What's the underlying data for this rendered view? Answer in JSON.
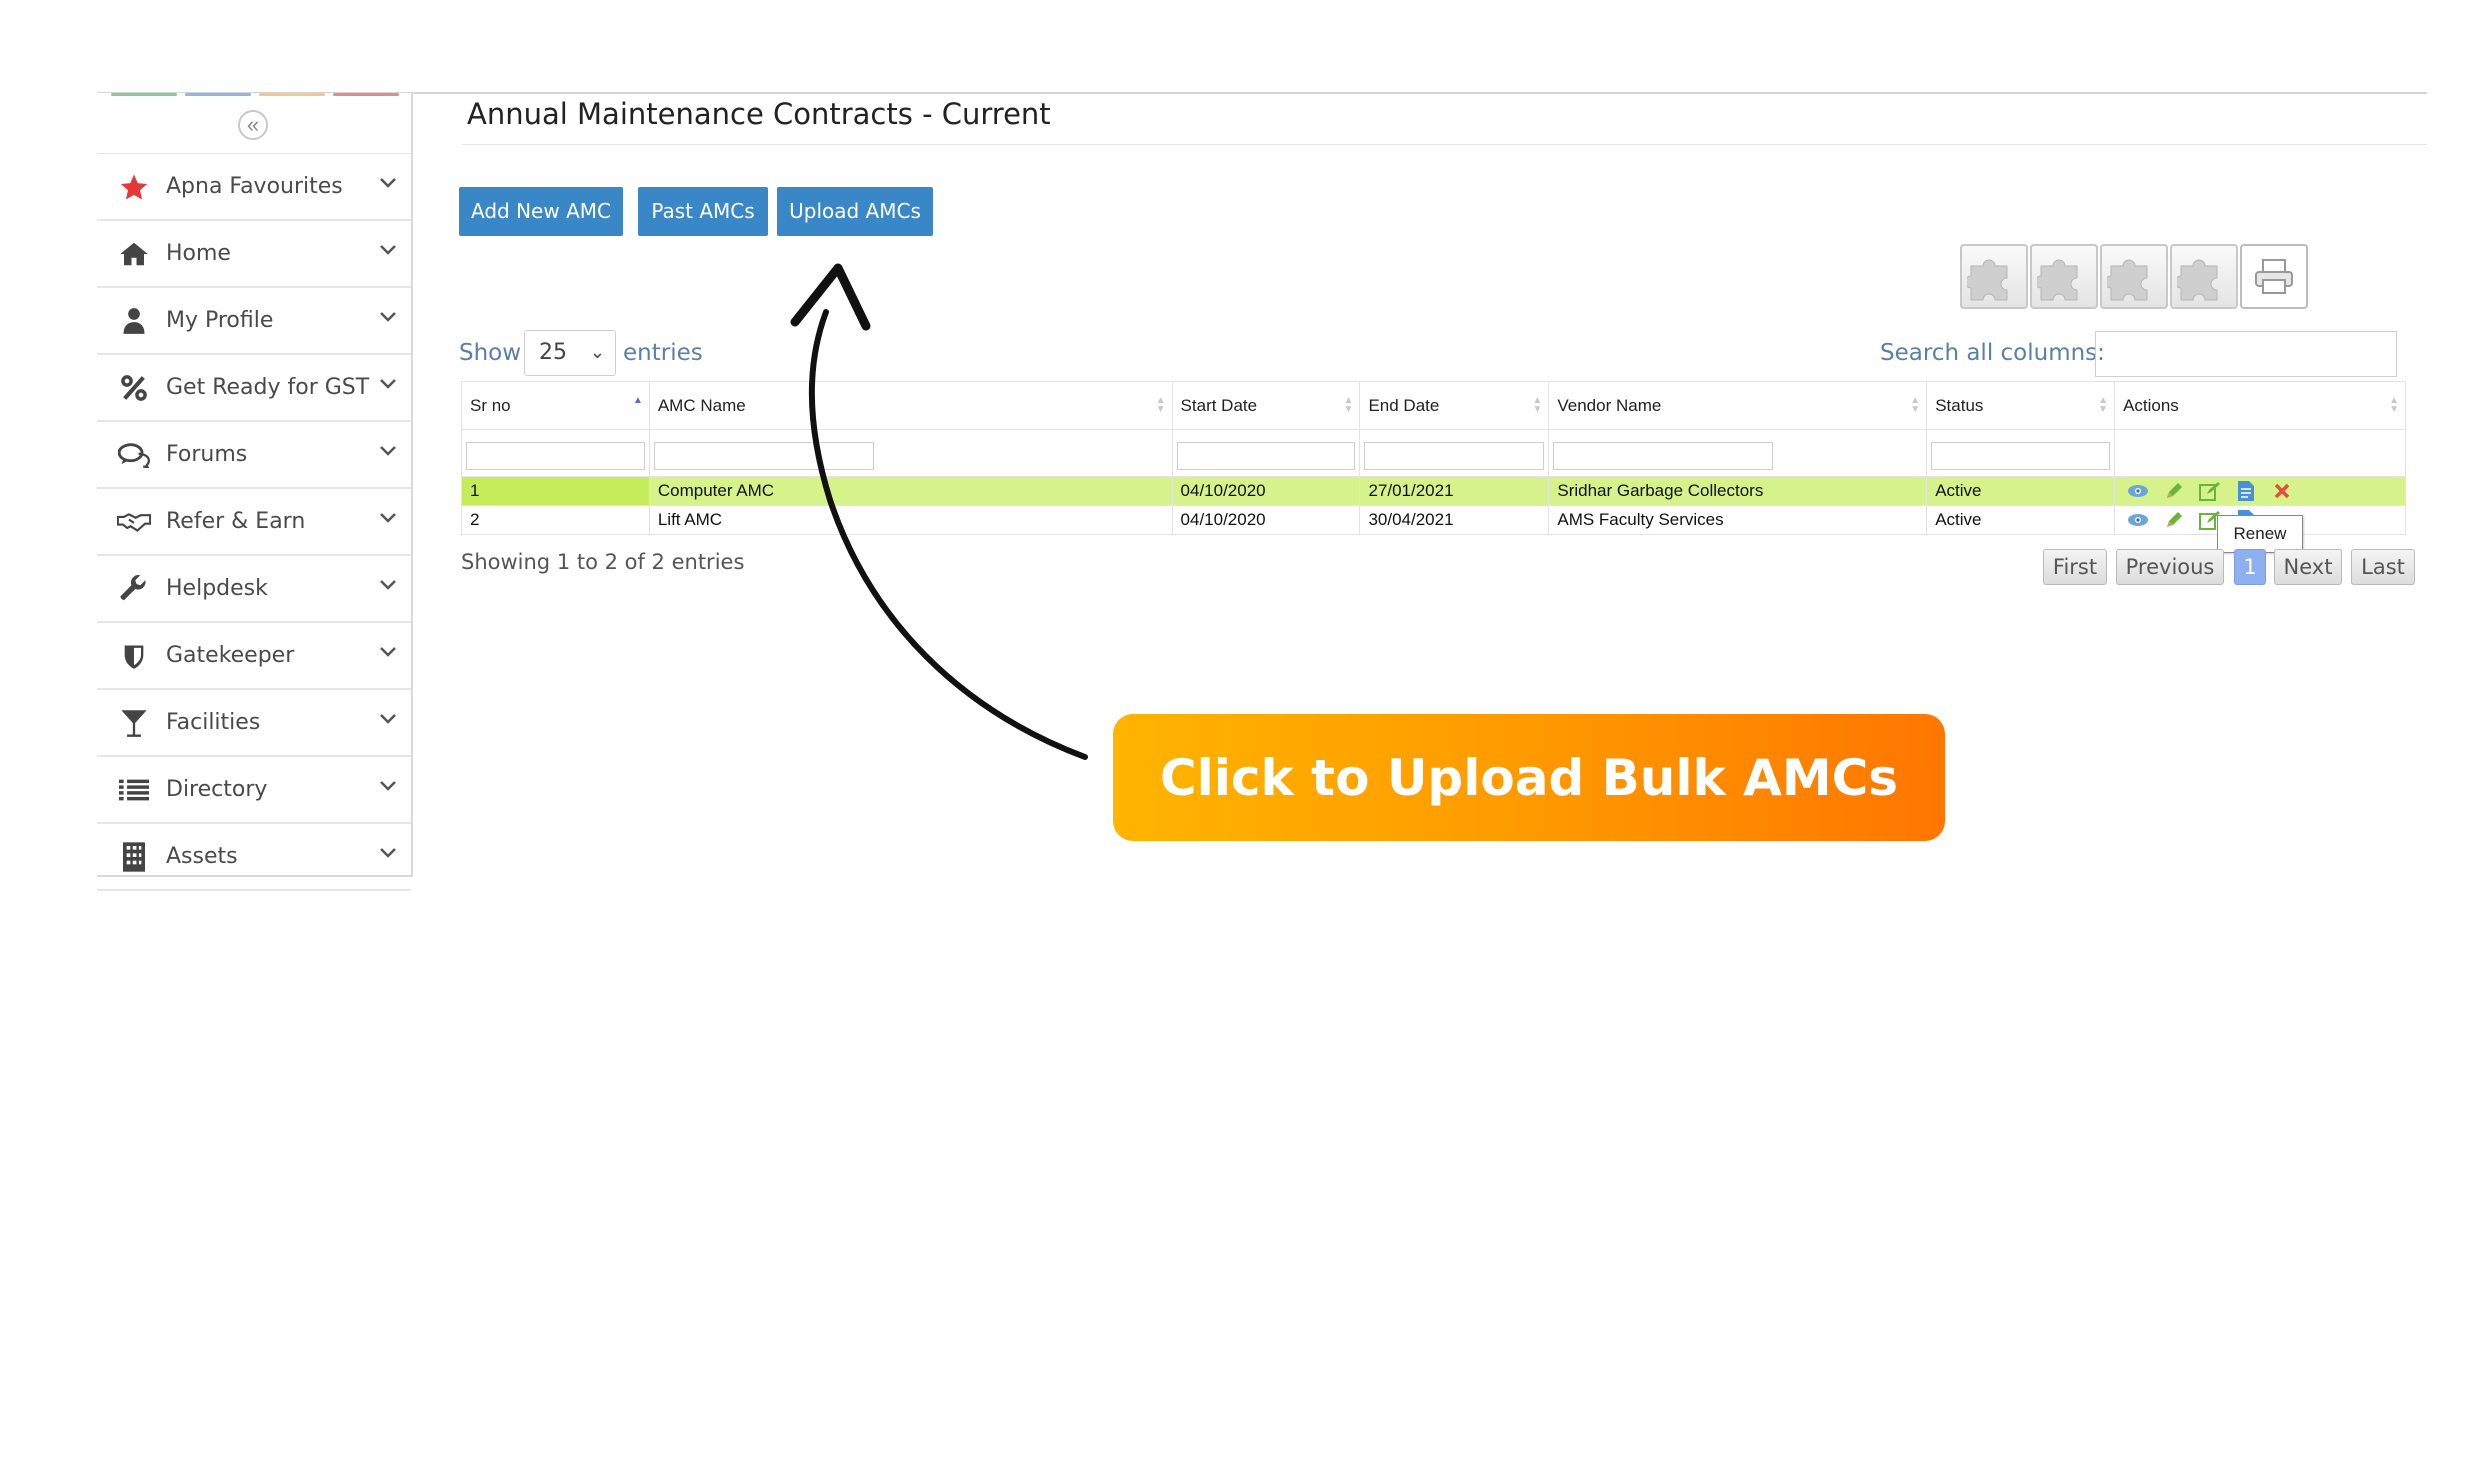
{
  "sidebar": {
    "collapse_glyph": "«",
    "items": [
      {
        "label": "Apna Favourites",
        "icon": "star-icon",
        "color": "#e53935"
      },
      {
        "label": "Home",
        "icon": "home-icon",
        "color": "#444"
      },
      {
        "label": "My Profile",
        "icon": "user-icon",
        "color": "#444"
      },
      {
        "label": "Get Ready for GST",
        "icon": "percent-icon",
        "color": "#444"
      },
      {
        "label": "Forums",
        "icon": "comments-icon",
        "color": "#444"
      },
      {
        "label": "Refer & Earn",
        "icon": "handshake-icon",
        "color": "#444"
      },
      {
        "label": "Helpdesk",
        "icon": "wrench-icon",
        "color": "#444"
      },
      {
        "label": "Gatekeeper",
        "icon": "shield-icon",
        "color": "#444"
      },
      {
        "label": "Facilities",
        "icon": "cocktail-icon",
        "color": "#444"
      },
      {
        "label": "Directory",
        "icon": "list-icon",
        "color": "#444"
      },
      {
        "label": "Assets",
        "icon": "building-icon",
        "color": "#444"
      }
    ]
  },
  "page": {
    "title": "Annual Maintenance Contracts - Current"
  },
  "actions": {
    "add": "Add New AMC",
    "past": "Past AMCs",
    "upload": "Upload AMCs"
  },
  "toolbar_icons": [
    "puzzle-icon",
    "puzzle-icon",
    "puzzle-icon",
    "puzzle-icon",
    "printer-icon"
  ],
  "table_controls": {
    "show_label": "Show",
    "page_size": "25",
    "entries_label": "entries",
    "search_label": "Search all columns:",
    "search_value": ""
  },
  "table": {
    "columns": [
      "Sr no",
      "AMC Name",
      "Start Date",
      "End Date",
      "Vendor Name",
      "Status",
      "Actions"
    ],
    "rows": [
      {
        "sr": "1",
        "name": "Computer AMC",
        "start": "04/10/2020",
        "end": "27/01/2021",
        "vendor": "Sridhar Garbage Collectors",
        "status": "Active"
      },
      {
        "sr": "2",
        "name": "Lift AMC",
        "start": "04/10/2020",
        "end": "30/04/2021",
        "vendor": "AMS Faculty Services",
        "status": "Active"
      }
    ],
    "row_action_icons": [
      "view-icon",
      "edit-icon",
      "renew-icon",
      "document-icon",
      "delete-icon"
    ],
    "tooltip": "Renew"
  },
  "footer": {
    "info": "Showing 1 to 2 of 2 entries",
    "first": "First",
    "previous": "Previous",
    "current_page": "1",
    "next": "Next",
    "last": "Last"
  },
  "callout": {
    "text": "Click to Upload Bulk AMCs"
  },
  "colors": {
    "primary_button": "#3a87c8",
    "highlight_row": "#d6f28a",
    "callout_start": "#ffb400",
    "callout_end": "#ff7600"
  }
}
